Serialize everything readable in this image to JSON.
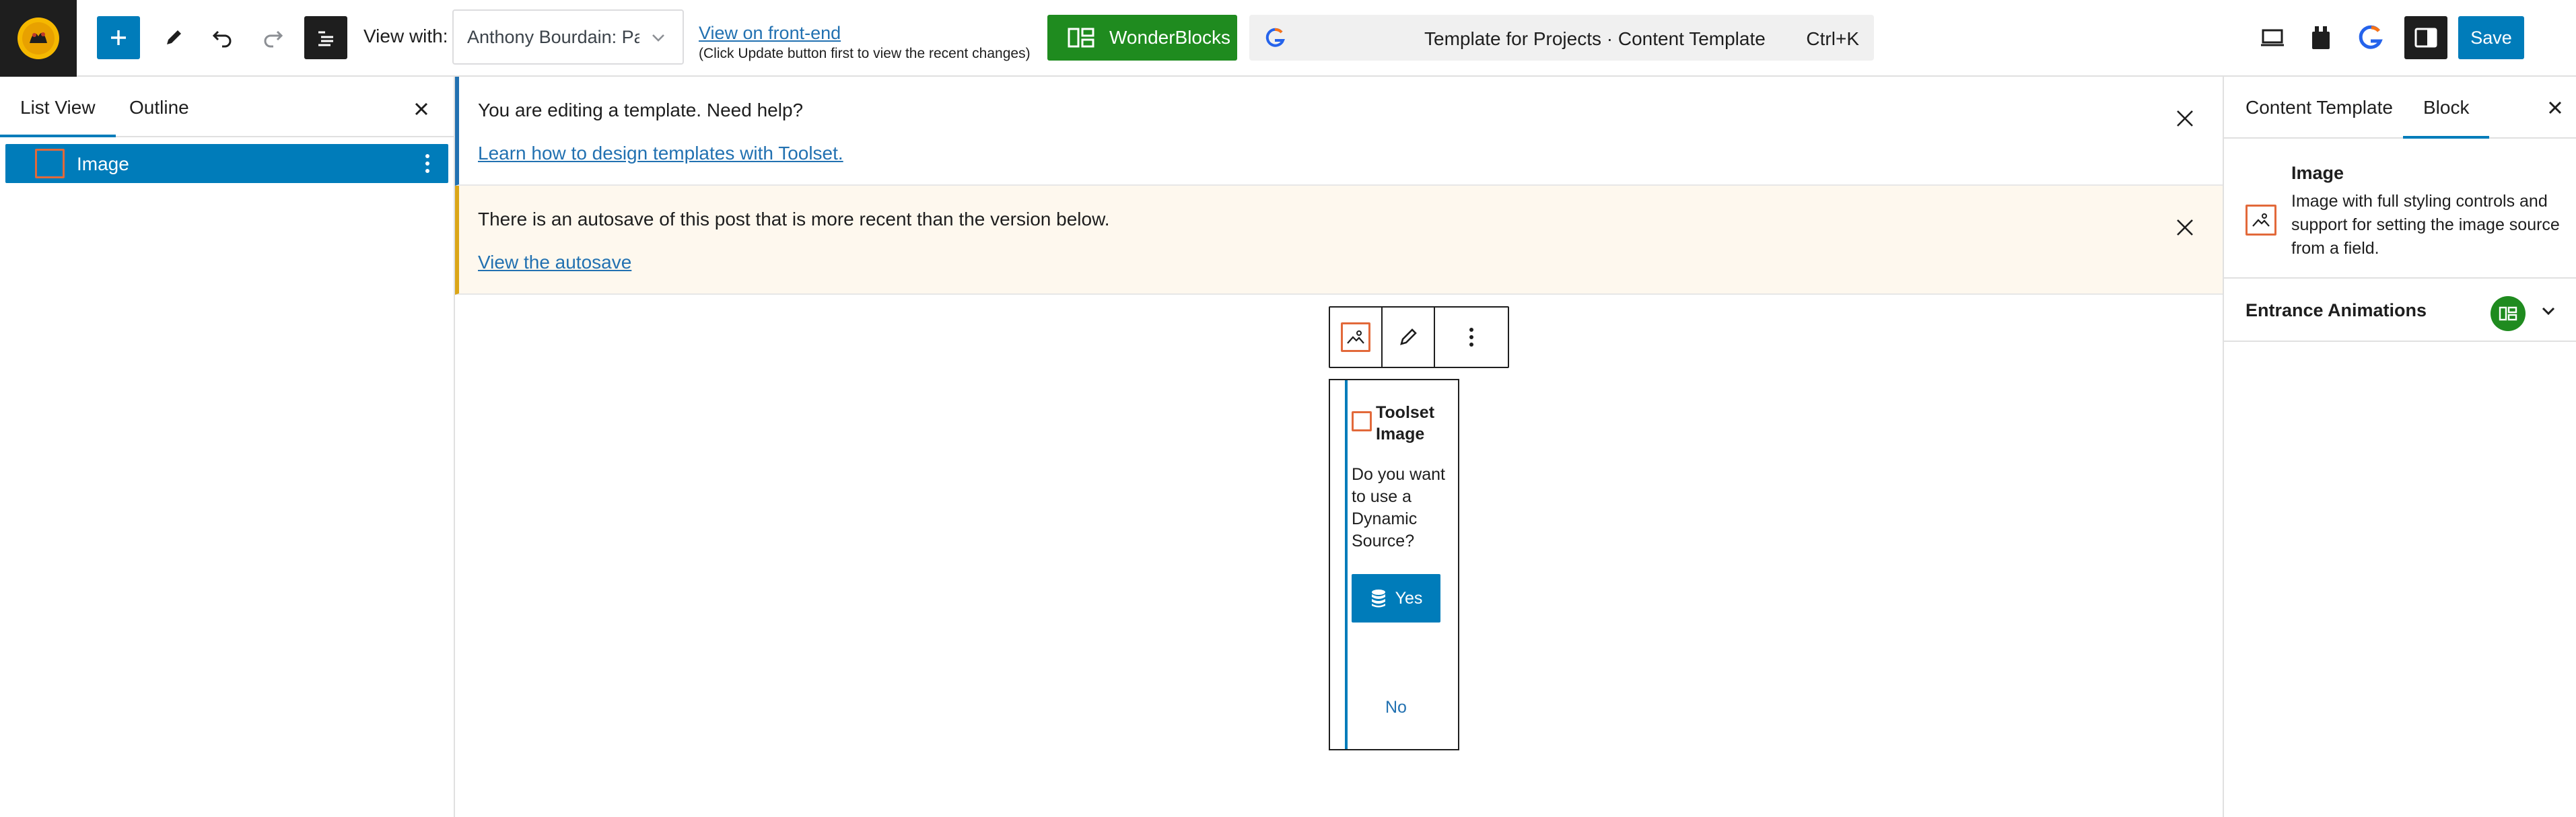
{
  "topbar": {
    "view_with_label": "View with:",
    "view_with_value": "Anthony Bourdain: Pa...",
    "front_end_link": "View on front-end",
    "front_end_hint": "(Click Update button first to view the recent changes)",
    "wonderblocks_label": "WonderBlocks",
    "command_text": "Template for Projects · Content Template",
    "command_shortcut": "Ctrl+K",
    "save_label": "Save"
  },
  "left_panel": {
    "tabs": [
      {
        "label": "List View",
        "active": true
      },
      {
        "label": "Outline",
        "active": false
      }
    ],
    "list_items": [
      {
        "label": "Image",
        "selected": true
      }
    ]
  },
  "notices": {
    "template": {
      "text": "You are editing a template. Need help?",
      "link": "Learn how to design templates with Toolset."
    },
    "autosave": {
      "text": "There is an autosave of this post that is more recent than the version below.",
      "link": "View the autosave"
    }
  },
  "block": {
    "title": "Toolset Image",
    "question": "Do you want to use a Dynamic Source?",
    "yes_label": "Yes",
    "no_label": "No"
  },
  "right_panel": {
    "tabs": [
      {
        "label": "Content Template",
        "active": false
      },
      {
        "label": "Block",
        "active": true
      }
    ],
    "block_name": "Image",
    "block_description": "Image with full styling controls and support for setting the image source from a field.",
    "entrance_animations_label": "Entrance Animations"
  },
  "colors": {
    "accent_blue": "#007cba",
    "link_blue": "#2271b1",
    "wonder_green": "#1f8b1f",
    "image_icon_orange": "#e2693a",
    "warning_bg": "#fef8ee",
    "warning_border": "#dba617"
  },
  "icons": [
    "site-logo-icon",
    "plus-icon",
    "pencil-icon",
    "undo-icon",
    "redo-icon",
    "document-overview-icon",
    "chevron-down-icon",
    "wonderblocks-icon",
    "g-icon",
    "desktop-preview-icon",
    "plugin-icon",
    "settings-sidebar-icon",
    "close-icon",
    "image-icon",
    "more-vertical-icon",
    "database-icon"
  ]
}
